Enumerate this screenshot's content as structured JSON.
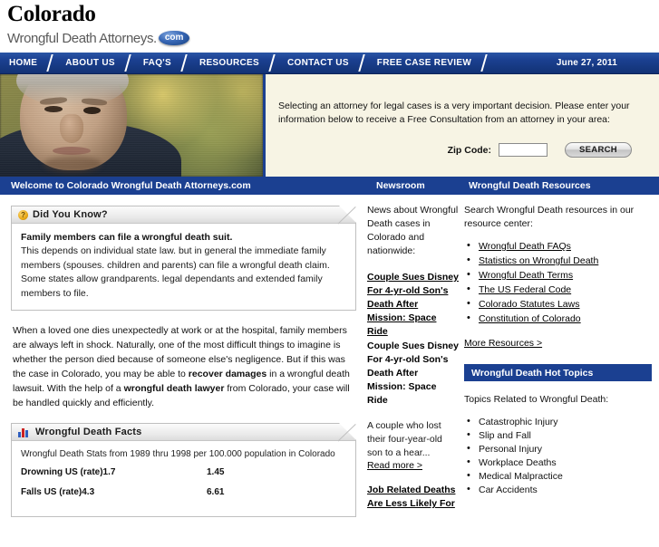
{
  "header": {
    "state": "Colorado",
    "site_name": "Wrongful Death Attorneys.",
    "tld_badge": "com"
  },
  "nav": {
    "items": [
      {
        "label": "HOME"
      },
      {
        "label": "ABOUT US"
      },
      {
        "label": "FAQ'S"
      },
      {
        "label": "RESOURCES"
      },
      {
        "label": "CONTACT US"
      },
      {
        "label": "FREE CASE REVIEW"
      }
    ],
    "date": "June 27, 2011"
  },
  "hero": {
    "photo_alt": "elderly-man-autumn-photo",
    "blurb": "Selecting an attorney for legal cases is a very important decision. Please enter your information below to receive a Free Consultation from an attorney in your area:",
    "zip_label": "Zip Code:",
    "zip_value": "",
    "zip_placeholder": "",
    "search_button": "SEARCH"
  },
  "welcome_bar": {
    "main": "Welcome to Colorado Wrongful Death Attorneys.com",
    "newsroom": "Newsroom",
    "resources": "Wrongful Death Resources"
  },
  "did_you_know": {
    "title": "Did You Know?",
    "icon": "question-mark-icon",
    "headline": "Family members can file a wrongful death suit.",
    "body": "This depends on individual state law. but in general the immediate family members (spouses. children and parents) can file a wrongful death claim. Some states allow grandparents. legal dependants and extended family members to file."
  },
  "main_article": {
    "part1": "When a loved one dies unexpectedly at work or at the hospital, family members are always left in shock. Naturally, one of the most difficult things to imagine is whether the person died because of someone else's negligence. But if this was the case in Colorado, you may be able to ",
    "bold1": "recover damages",
    "part2": " in a wrongful death lawsuit. With the help of a ",
    "bold2": "wrongful death lawyer",
    "part3": " from Colorado, your case will be handled quickly and efficiently."
  },
  "facts_panel": {
    "title": "Wrongful Death Facts",
    "icon": "bar-chart-icon",
    "intro": "Wrongful Death Stats from 1989 thru 1998 per 100.000 population in Colorado",
    "rows": [
      {
        "label": "Drowning US (rate)1.7",
        "value": "1.45"
      },
      {
        "label": "Falls US (rate)4.3",
        "value": "6.61"
      }
    ]
  },
  "newsroom": {
    "intro": "News about Wrongful Death cases in Colorado and nationwide:",
    "link_headline": "Couple Sues Disney For 4-yr-old Son's Death After Mission: Space Ride",
    "title_repeat": "Couple Sues Disney For 4-yr-old Son's Death After Mission: Space Ride",
    "snippet": "A couple who lost their four-year-old son to a hear...",
    "read_more": "Read more >",
    "next_headline": "Job Related Deaths Are Less Likely For"
  },
  "resources": {
    "intro": "Search Wrongful Death resources in our resource center:",
    "links": [
      "Wrongful Death FAQs",
      "Statistics on Wrongful Death",
      "Wrongful Death Terms",
      "The US Federal Code",
      "Colorado Statutes Laws",
      "Constitution of Colorado"
    ],
    "more": "More Resources >"
  },
  "hot_topics": {
    "title": "Wrongful Death Hot Topics",
    "intro": "Topics Related to Wrongful Death:",
    "items": [
      "Catastrophic Injury",
      "Slip and Fall",
      "Personal Injury",
      "Workplace Deaths",
      "Medical Malpractice",
      "Car Accidents"
    ]
  },
  "colors": {
    "brand_blue": "#1b4091",
    "cream": "#f7f4e4",
    "accent_gold": "#e8a918"
  }
}
